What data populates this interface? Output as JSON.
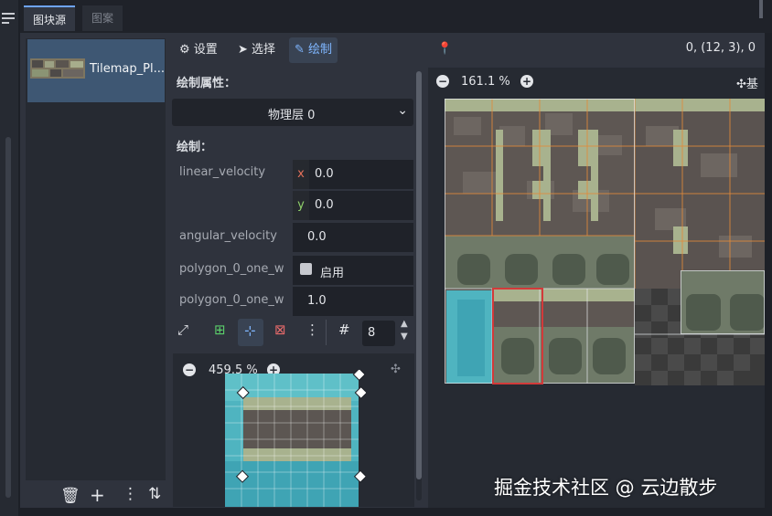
{
  "tabs": [
    "图块源",
    "图案"
  ],
  "source_list": {
    "items": [
      {
        "label": "Tilemap_Pl..."
      }
    ]
  },
  "toolbar": {
    "setup": "设置",
    "select": "选择",
    "paint": "绘制"
  },
  "coords": "0, (12, 3), 0",
  "paint_properties": {
    "header": "绘制属性：",
    "layer_dropdown": "物理层 0",
    "paint_header": "绘制：",
    "rows": [
      {
        "label": "linear_velocity",
        "x_axis": "x",
        "x": "0.0",
        "y_axis": "y",
        "y": "0.0"
      },
      {
        "label": "angular_velocity",
        "value": "0.0"
      },
      {
        "label": "polygon_0_one_w",
        "checkbox_label": "启用"
      },
      {
        "label": "polygon_0_one_w",
        "value": "1.0"
      }
    ]
  },
  "snap_value": "8",
  "mini_zoom": "459.5 %",
  "big_zoom": "161.1 %",
  "big_top_right": "基",
  "watermark": "掘金技术社区 @ 云边散步",
  "colors": {
    "accent": "#6ea4ff",
    "selected_item": "#3e5773",
    "selection_red": "#d23a3a",
    "grid_orange": "#e08a3a",
    "water": "#4fb4c0"
  }
}
